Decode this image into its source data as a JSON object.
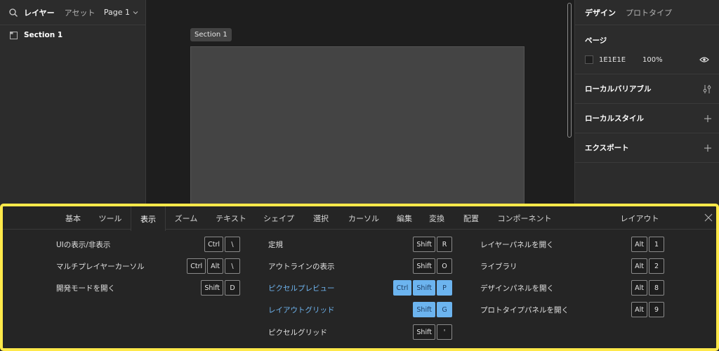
{
  "left_panel": {
    "tab_layers": "レイヤー",
    "tab_assets": "アセット",
    "page_selector": "Page 1",
    "layers": [
      {
        "name": "Section 1"
      }
    ]
  },
  "canvas": {
    "section_label": "Section 1"
  },
  "right_panel": {
    "tab_design": "デザイン",
    "tab_prototype": "プロトタイプ",
    "page_title": "ページ",
    "page_color": "1E1E1E",
    "page_opacity": "100%",
    "local_variables": "ローカルバリアブル",
    "local_styles": "ローカルスタイル",
    "export": "エクスポート"
  },
  "shortcuts": {
    "tabs": [
      "基本",
      "ツール",
      "表示",
      "ズーム",
      "テキスト",
      "シェイプ",
      "選択",
      "カーソル",
      "編集",
      "変換",
      "配置",
      "コンポーネント",
      "レイアウト"
    ],
    "active_tab": "表示",
    "items": [
      {
        "label": "UIの表示/非表示",
        "keys": [
          "Ctrl",
          "\\"
        ],
        "col": 0,
        "row": 0,
        "highlight": false
      },
      {
        "label": "マルチプレイヤーカーソル",
        "keys": [
          "Ctrl",
          "Alt",
          "\\"
        ],
        "col": 0,
        "row": 1,
        "highlight": false
      },
      {
        "label": "開発モードを開く",
        "keys": [
          "Shift",
          "D"
        ],
        "col": 0,
        "row": 2,
        "highlight": false
      },
      {
        "label": "定規",
        "keys": [
          "Shift",
          "R"
        ],
        "col": 1,
        "row": 0,
        "highlight": false
      },
      {
        "label": "アウトラインの表示",
        "keys": [
          "Shift",
          "O"
        ],
        "col": 1,
        "row": 1,
        "highlight": false
      },
      {
        "label": "ピクセルプレビュー",
        "keys": [
          "Ctrl",
          "Shift",
          "P"
        ],
        "col": 1,
        "row": 2,
        "highlight": true
      },
      {
        "label": "レイアウトグリッド",
        "keys": [
          "Shift",
          "G"
        ],
        "col": 1,
        "row": 3,
        "highlight": true
      },
      {
        "label": "ピクセルグリッド",
        "keys": [
          "Shift",
          "'"
        ],
        "col": 1,
        "row": 4,
        "highlight": false
      },
      {
        "label": "レイヤーパネルを開く",
        "keys": [
          "Alt",
          "1"
        ],
        "col": 2,
        "row": 0,
        "highlight": false
      },
      {
        "label": "ライブラリ",
        "keys": [
          "Alt",
          "2"
        ],
        "col": 2,
        "row": 1,
        "highlight": false
      },
      {
        "label": "デザインパネルを開く",
        "keys": [
          "Alt",
          "8"
        ],
        "col": 2,
        "row": 2,
        "highlight": false
      },
      {
        "label": "プロトタイプパネルを開く",
        "keys": [
          "Alt",
          "9"
        ],
        "col": 2,
        "row": 3,
        "highlight": false
      }
    ]
  },
  "colors": {
    "highlight_border": "#ffe94a",
    "accent_blue": "#6cb4ef"
  },
  "icons": [
    "search-icon",
    "chevron-down-icon",
    "frame-icon",
    "eye-icon",
    "adjust-icon",
    "plus-icon",
    "close-icon"
  ]
}
